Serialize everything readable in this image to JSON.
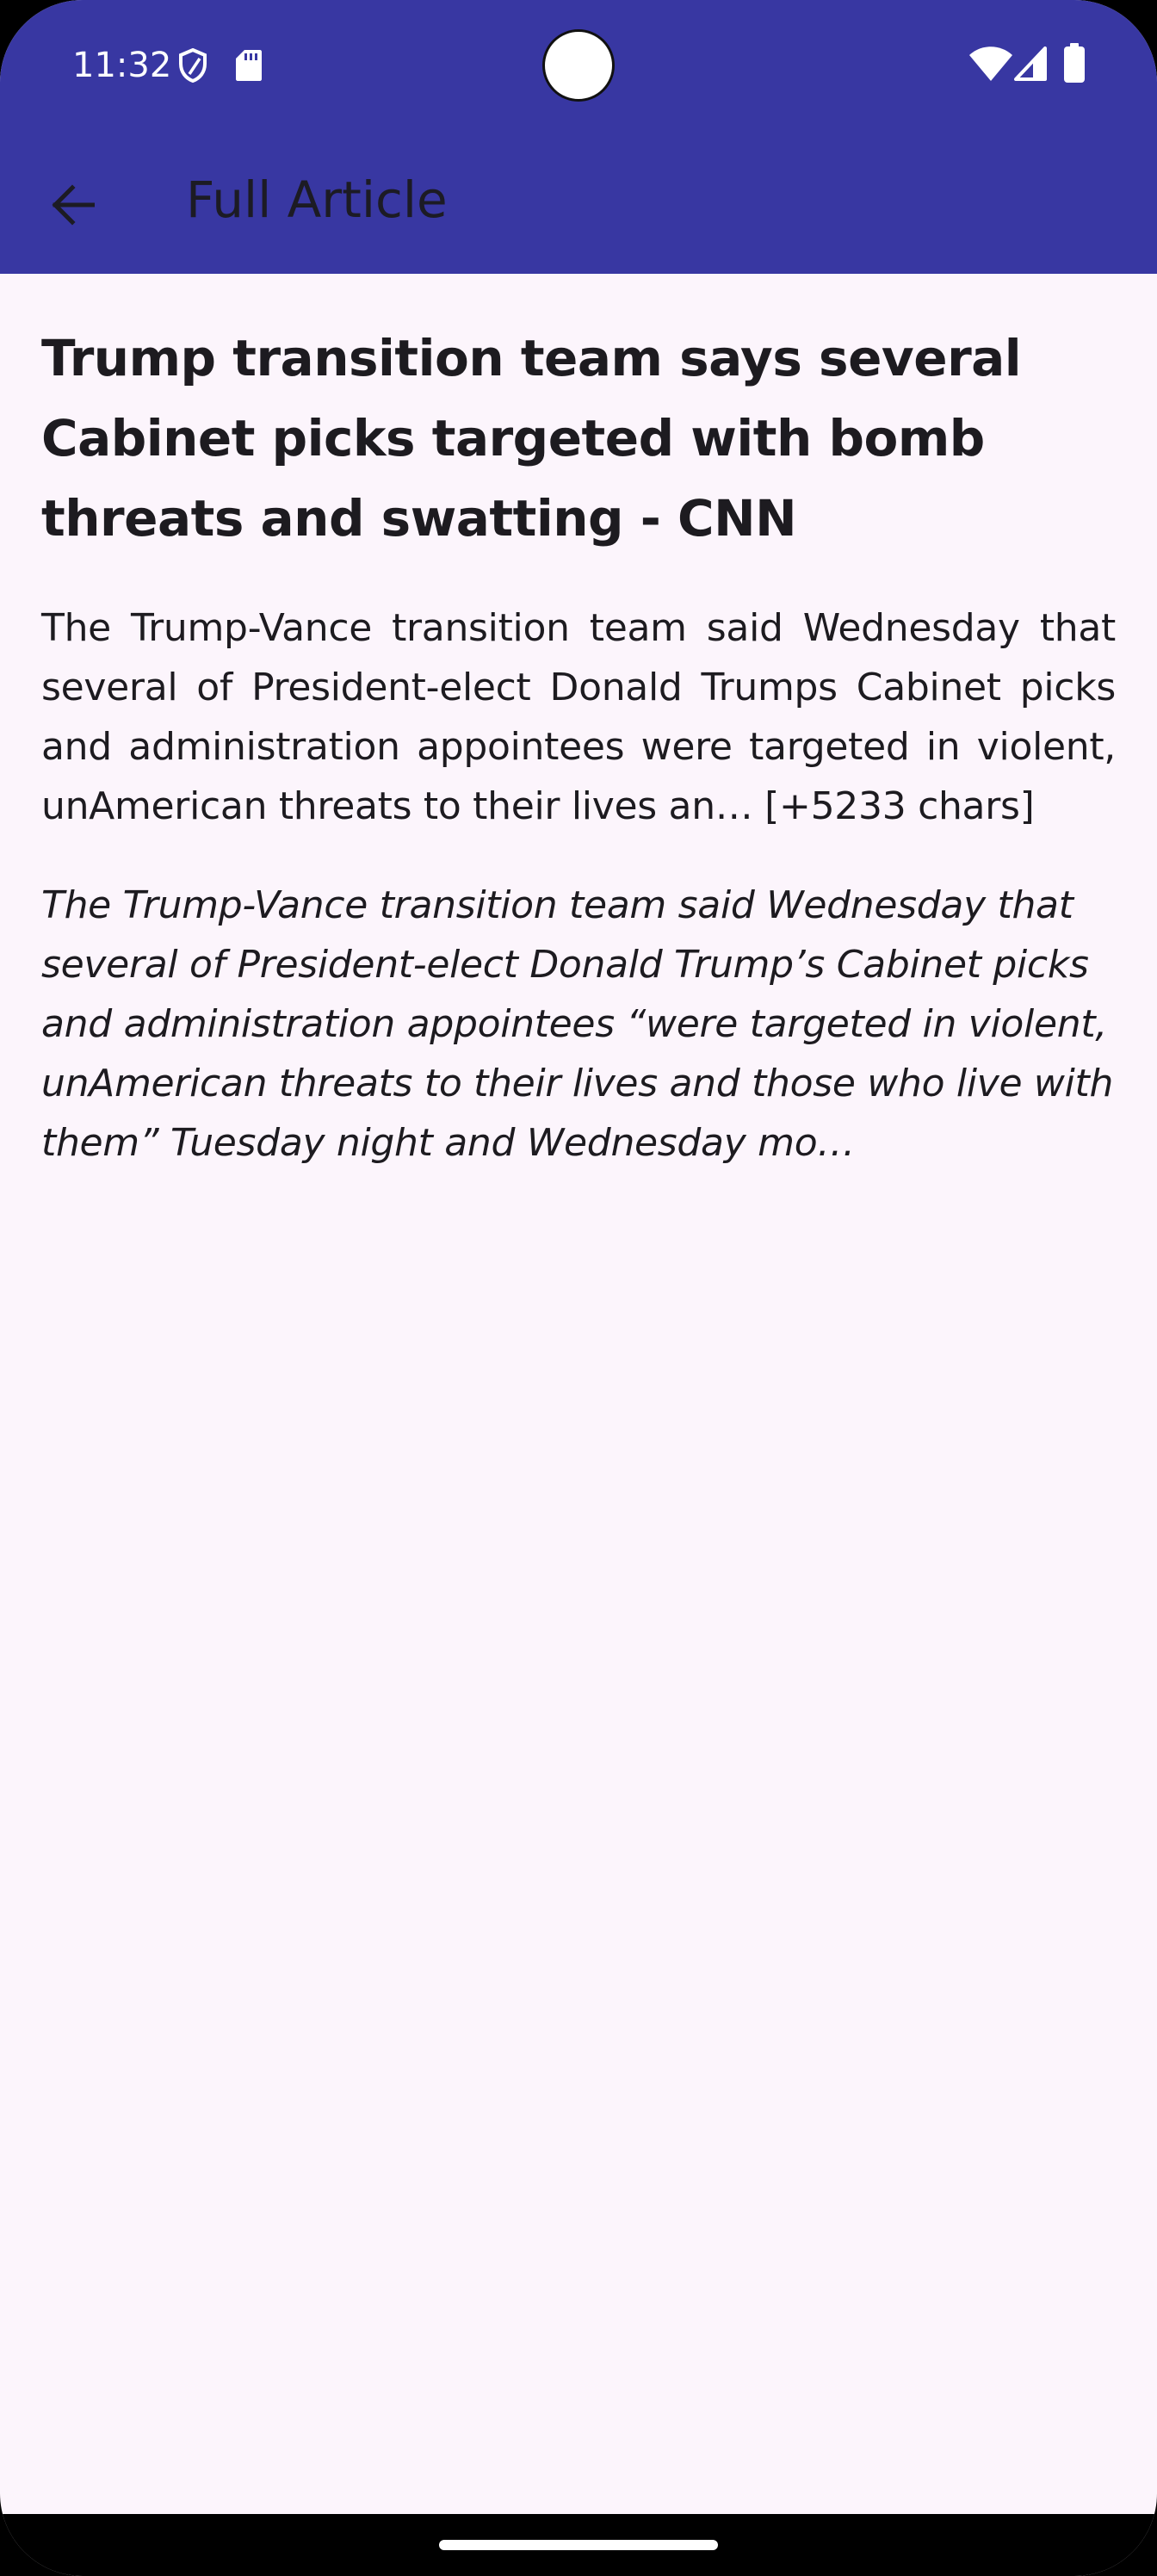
{
  "status_bar": {
    "time": "11:32",
    "icons": [
      "shield-icon",
      "sd-card-icon",
      "wifi-icon",
      "signal-icon",
      "battery-icon"
    ]
  },
  "app_bar": {
    "title": "Full Article",
    "back_icon": "arrow-back-icon",
    "background_color": "#3837a2"
  },
  "article": {
    "title": "Trump transition team says several Cabinet picks targeted with bomb threats and swatting - CNN",
    "description": "The Trump-Vance transition team said Wednesday that several of President-elect Donald Trumps Cabinet picks and administration appointees were targeted in violent, unAmerican threats to their lives an… [+5233 chars]",
    "content": "The Trump-Vance transition team said Wednesday that several of President-elect Donald Trump’s Cabinet picks and administration appointees “were targeted in violent, unAmerican threats to their lives and those who live with them” Tuesday night and Wednesday mo…"
  },
  "colors": {
    "page_background": "#fcf5fc",
    "text": "#1d1b20"
  }
}
